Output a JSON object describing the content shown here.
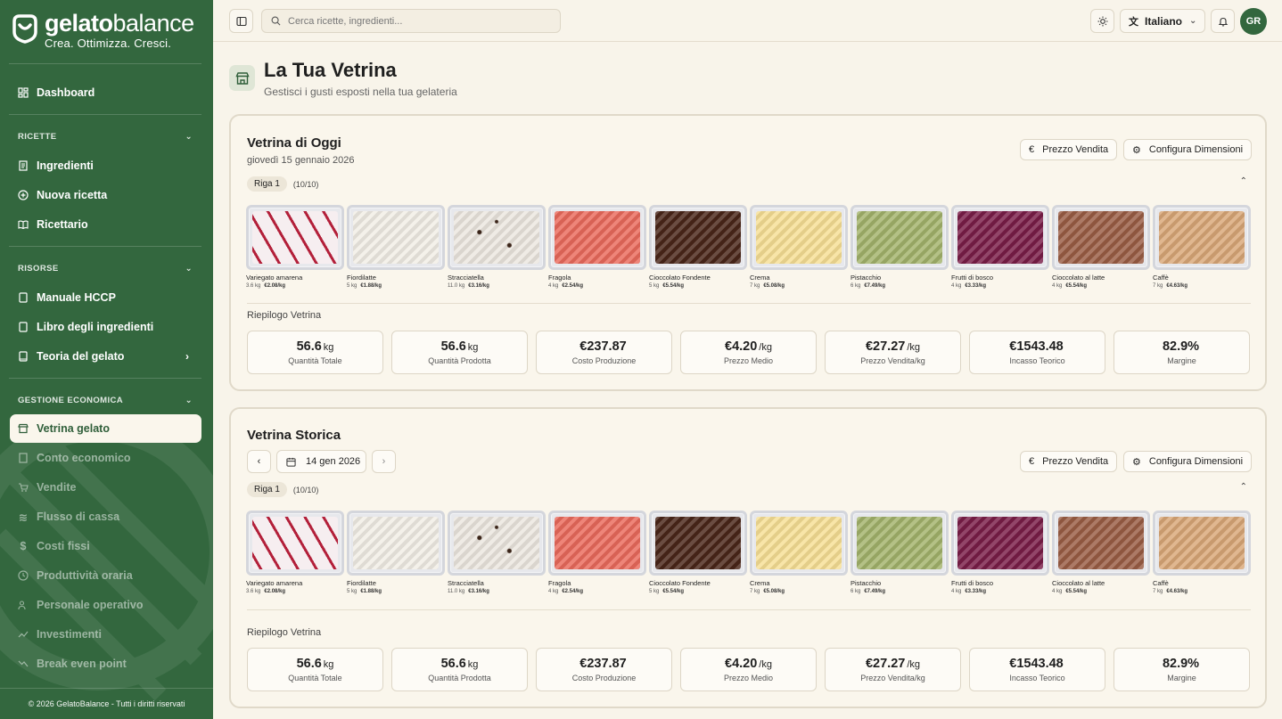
{
  "brand": {
    "name_bold": "gelato",
    "name_light": "balance",
    "tagline": "Crea. Ottimizza. Cresci."
  },
  "sidebar": {
    "dashboard": "Dashboard",
    "sections": {
      "ricette": "RICETTE",
      "risorse": "RISORSE",
      "gestione": "GESTIONE ECONOMICA"
    },
    "ricette_items": [
      "Ingredienti",
      "Nuova ricetta",
      "Ricettario"
    ],
    "risorse_items": [
      "Manuale HCCP",
      "Libro degli ingredienti",
      "Teoria del gelato"
    ],
    "gestione_items": [
      "Vetrina gelato",
      "Conto economico",
      "Vendite",
      "Flusso di cassa",
      "Costi fissi",
      "Produttività oraria",
      "Personale operativo",
      "Investimenti",
      "Break even point"
    ],
    "footer": "© 2026 GelatoBalance - Tutti i diritti riservati"
  },
  "topbar": {
    "search_placeholder": "Cerca ricette, ingredienti...",
    "language": "Italiano",
    "avatar_initials": "GR"
  },
  "page": {
    "title": "La Tua Vetrina",
    "subtitle": "Gestisci i gusti esposti nella tua gelateria"
  },
  "today": {
    "title": "Vetrina di Oggi",
    "date": "giovedì 15 gennaio 2026"
  },
  "historic": {
    "title": "Vetrina Storica",
    "date": "14 gen 2026"
  },
  "actions": {
    "prezzo": "Prezzo Vendita",
    "configura": "Configura Dimensioni"
  },
  "row": {
    "label": "Riga 1",
    "count": "(10/10)"
  },
  "flavors": [
    {
      "name": "Variegato amarena",
      "qty": "3.6 kg",
      "price": "€2.08/kg"
    },
    {
      "name": "Fiordilatte",
      "qty": "5 kg",
      "price": "€1.88/kg"
    },
    {
      "name": "Stracciatella",
      "qty": "11.0 kg",
      "price": "€3.16/kg"
    },
    {
      "name": "Fragola",
      "qty": "4 kg",
      "price": "€2.54/kg"
    },
    {
      "name": "Cioccolato Fondente",
      "qty": "5 kg",
      "price": "€5.54/kg"
    },
    {
      "name": "Crema",
      "qty": "7 kg",
      "price": "€5.08/kg"
    },
    {
      "name": "Pistacchio",
      "qty": "6 kg",
      "price": "€7.49/kg"
    },
    {
      "name": "Frutti di bosco",
      "qty": "4 kg",
      "price": "€3.33/kg"
    },
    {
      "name": "Cioccolato al latte",
      "qty": "4 kg",
      "price": "€5.54/kg"
    },
    {
      "name": "Caffè",
      "qty": "7 kg",
      "price": "€4.63/kg"
    }
  ],
  "summary": {
    "title": "Riepilogo Vetrina",
    "stats": [
      {
        "value": "56.6",
        "unit": "kg",
        "label": "Quantità Totale"
      },
      {
        "value": "56.6",
        "unit": "kg",
        "label": "Quantità Prodotta"
      },
      {
        "value": "€237.87",
        "unit": "",
        "label": "Costo Produzione"
      },
      {
        "value": "€4.20",
        "unit": "/kg",
        "label": "Prezzo Medio"
      },
      {
        "value": "€27.27",
        "unit": "/kg",
        "label": "Prezzo Vendita/kg"
      },
      {
        "value": "€1543.48",
        "unit": "",
        "label": "Incasso Teorico"
      },
      {
        "value": "82.9%",
        "unit": "",
        "label": "Margine"
      }
    ]
  },
  "colors": {
    "sidebar": "#33673e",
    "background": "#f8f4ea",
    "flavor_fills": [
      "#b3203a",
      "#f2eee6",
      "#ece7df",
      "#ea6a5c",
      "#4a2619",
      "#f7df95",
      "#a3b36b",
      "#7a1d48",
      "#9a5d44",
      "#d9a777"
    ]
  }
}
